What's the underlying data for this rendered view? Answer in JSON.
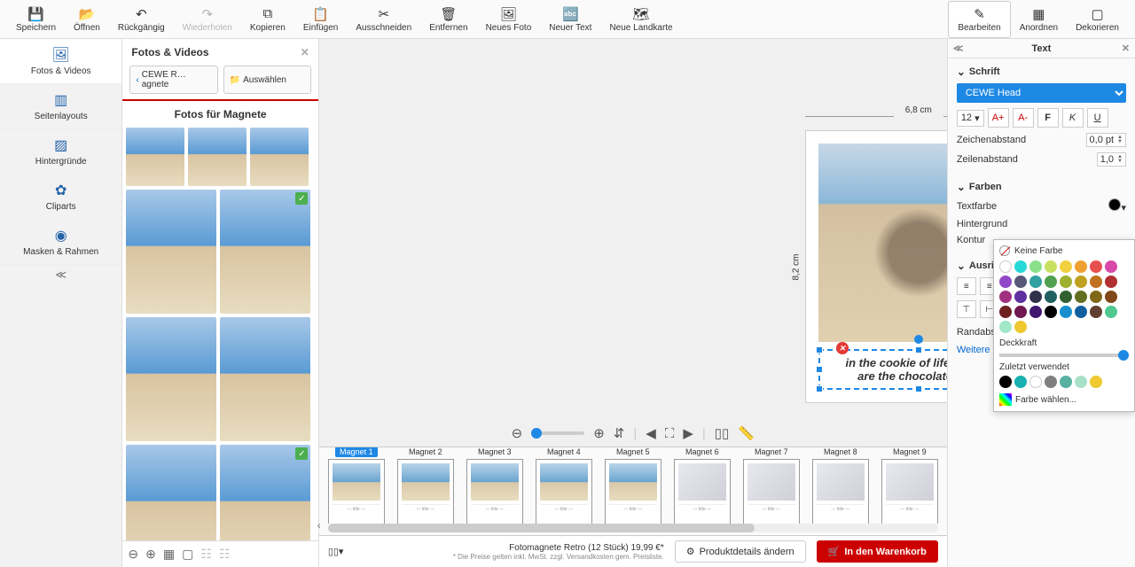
{
  "toolbar": {
    "save": "Speichern",
    "open": "Öffnen",
    "undo": "Rückgängig",
    "redo": "Wiederholen",
    "copy": "Kopieren",
    "paste": "Einfügen",
    "cut": "Ausschneiden",
    "remove": "Entfernen",
    "newphoto": "Neues Foto",
    "newtext": "Neuer Text",
    "newmap": "Neue Landkarte",
    "edit": "Bearbeiten",
    "arrange": "Anordnen",
    "decorate": "Dekorieren"
  },
  "lnav": {
    "photos": "Fotos & Videos",
    "layouts": "Seitenlayouts",
    "bg": "Hintergründe",
    "cliparts": "Cliparts",
    "masks": "Masken & Rahmen"
  },
  "gallery": {
    "title": "Fotos & Videos",
    "crumb": "CEWE R…agnete",
    "select": "Auswählen",
    "subtitle": "Fotos für Magnete"
  },
  "canvas": {
    "w": "6,8 cm",
    "h": "8,2 cm",
    "text1": "in the cookie of life friends",
    "text2": "are the chocolate chip"
  },
  "magnets": [
    "Magnet 1",
    "Magnet 2",
    "Magnet 3",
    "Magnet 4",
    "Magnet 5",
    "Magnet 6",
    "Magnet 7",
    "Magnet 8",
    "Magnet 9"
  ],
  "footer": {
    "product": "Fotomagnete Retro (12 Stück) 19,99 €*",
    "disclaimer": "* Die Preise gelten inkl. MwSt. zzgl. Versandkosten gem. Preisliste.",
    "details": "Produktdetails ändern",
    "cart": "In den Warenkorb"
  },
  "right": {
    "panel": "Text",
    "font": "Schrift",
    "fontname": "CEWE Head",
    "size": "12",
    "charspace_l": "Zeichenabstand",
    "charspace_v": "0,0 pt",
    "linespace_l": "Zeilenabstand",
    "linespace_v": "1,0",
    "colors": "Farben",
    "textcolor": "Textfarbe",
    "bgcolor": "Hintergrund",
    "outline": "Kontur",
    "align": "Ausrichtung",
    "margin": "Randabstand",
    "more": "Weitere Funk…"
  },
  "popup": {
    "nocolor": "Keine Farbe",
    "opacity": "Deckkraft",
    "recent": "Zuletzt verwendet",
    "choose": "Farbe wählen...",
    "swatches": [
      "#ffffff",
      "#28d8d8",
      "#8be08b",
      "#c8e060",
      "#f0d040",
      "#f0a030",
      "#e85050",
      "#d848a8",
      "#9048c8",
      "#585878",
      "#30a0a0",
      "#50a050",
      "#a0b030",
      "#c0a020",
      "#c07020",
      "#b03030",
      "#a03080",
      "#6030a0",
      "#303048",
      "#206060",
      "#306030",
      "#607020",
      "#806818",
      "#804818",
      "#702020",
      "#701850",
      "#401870",
      "#000000",
      "#1890d0",
      "#1060a0",
      "#604030",
      "#50c890",
      "#a0e8c8",
      "#f0c830"
    ],
    "recents": [
      "#000000",
      "#18b0b0",
      "#ffffff",
      "#808080",
      "#58b0a0",
      "#a8e0c8",
      "#f0c830"
    ]
  }
}
